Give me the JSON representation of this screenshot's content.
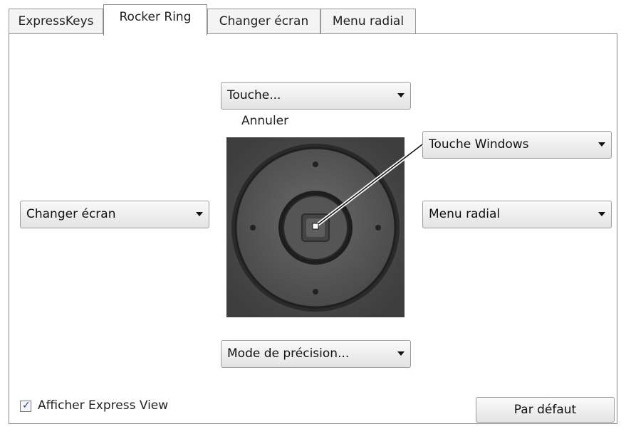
{
  "tabs": [
    {
      "label": "ExpressKeys",
      "active": false
    },
    {
      "label": "Rocker Ring",
      "active": true
    },
    {
      "label": "Changer écran",
      "active": false
    },
    {
      "label": "Menu radial",
      "active": false
    }
  ],
  "rocker": {
    "top_select": "Touche...",
    "top_caption": "Annuler",
    "left_select": "Changer écran",
    "right_top_select": "Touche Windows",
    "right_select": "Menu radial",
    "bottom_select": "Mode de précision..."
  },
  "footer": {
    "express_view_label": "Afficher Express View",
    "express_view_checked": true,
    "default_button": "Par défaut"
  }
}
